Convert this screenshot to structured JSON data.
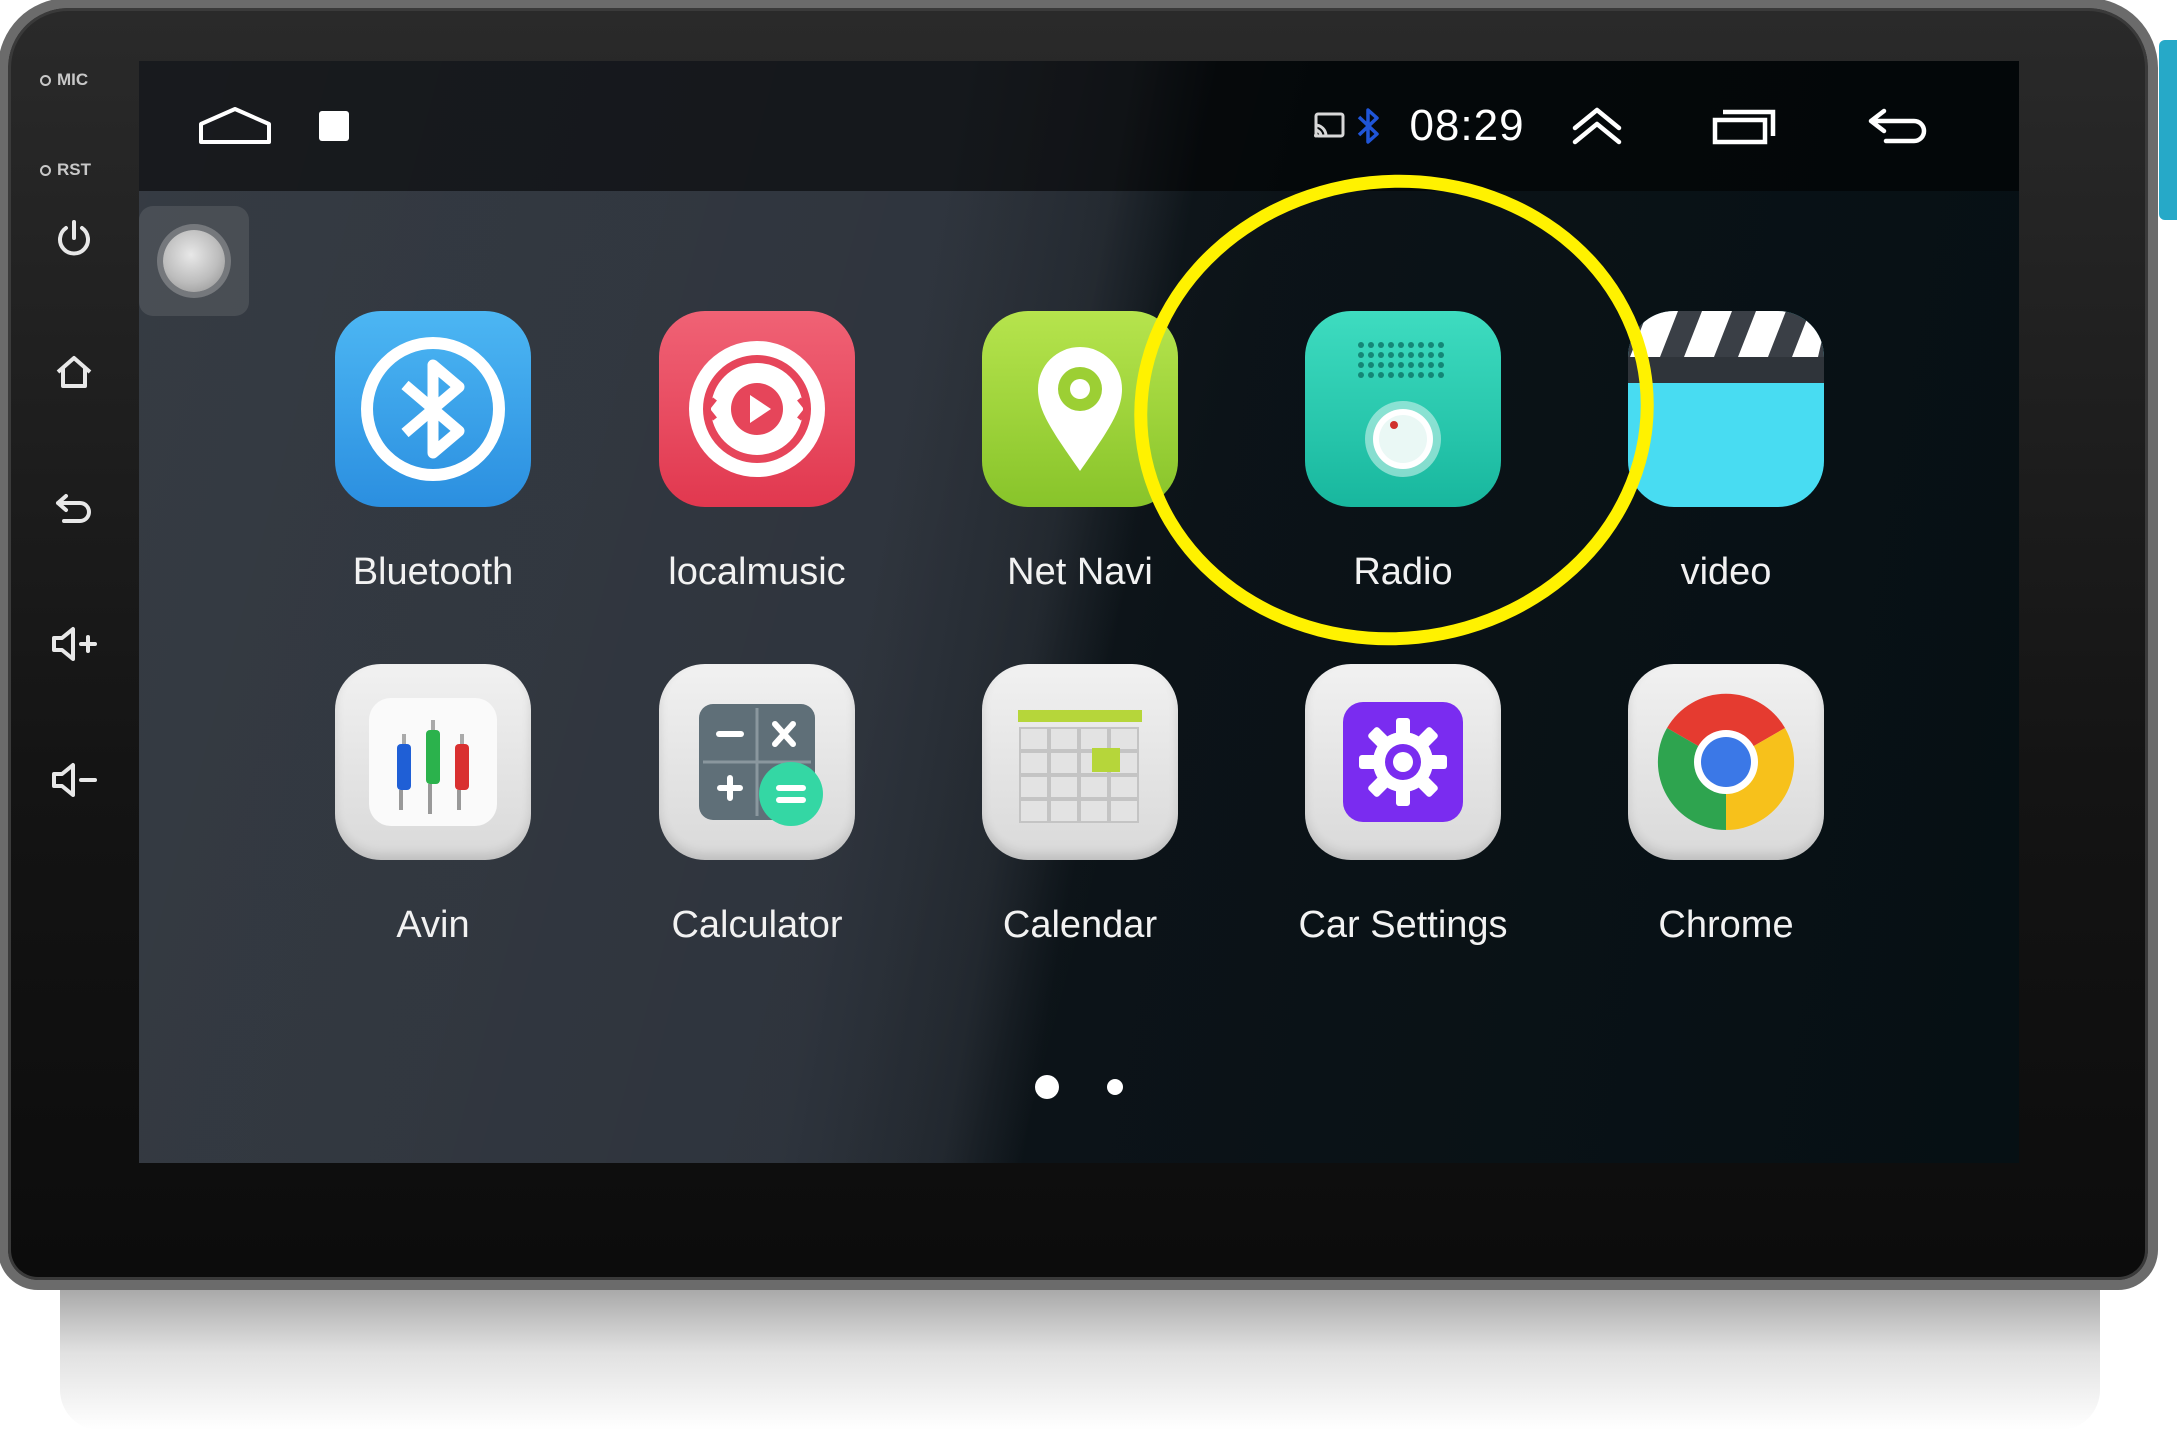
{
  "device": {
    "side_labels": {
      "mic": "MIC",
      "rst": "RST"
    },
    "side_buttons": [
      "power-icon",
      "home-icon",
      "back-icon",
      "volume-up-icon",
      "volume-down-icon"
    ]
  },
  "status_bar": {
    "clock": "08:29",
    "left_icons": [
      "home-outline-icon",
      "stop-square-icon"
    ],
    "right_icons": [
      "cast-icon",
      "bluetooth-icon",
      "double-chevron-up-icon",
      "recent-apps-icon",
      "back-arrow-icon"
    ]
  },
  "apps": {
    "row1": [
      {
        "label": "Bluetooth",
        "icon": "bluetooth-app-icon"
      },
      {
        "label": "localmusic",
        "icon": "local-music-icon"
      },
      {
        "label": "Net Navi",
        "icon": "map-pin-icon"
      },
      {
        "label": "Radio",
        "icon": "radio-icon"
      },
      {
        "label": "video",
        "icon": "clapperboard-icon"
      }
    ],
    "row2": [
      {
        "label": "Avin",
        "icon": "av-input-icon"
      },
      {
        "label": "Calculator",
        "icon": "calculator-icon"
      },
      {
        "label": "Calendar",
        "icon": "calendar-icon"
      },
      {
        "label": "Car Settings",
        "icon": "gear-icon"
      },
      {
        "label": "Chrome",
        "icon": "chrome-icon"
      }
    ]
  },
  "pager": {
    "pages": 2,
    "current": 1
  },
  "colors": {
    "highlight": "#fff200",
    "bluetooth": "#3aa6ea",
    "localmusic": "#ea4d63",
    "netnavi": "#9ed43a",
    "radio": "#27cbb0",
    "video": "#48dcf2",
    "settings": "#7a2cf0"
  }
}
